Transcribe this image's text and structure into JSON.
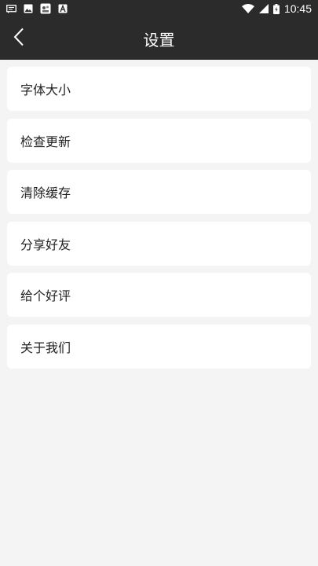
{
  "status_bar": {
    "time": "10:45",
    "icons": [
      "message-notification-icon",
      "image-notification-icon",
      "app-notification-icon",
      "font-app-icon",
      "wifi-icon",
      "signal-icon",
      "battery-icon"
    ]
  },
  "header": {
    "title": "设置",
    "back_icon": "chevron-left-icon"
  },
  "settings": {
    "items": [
      {
        "label": "字体大小"
      },
      {
        "label": "检查更新"
      },
      {
        "label": "清除缓存"
      },
      {
        "label": "分享好友"
      },
      {
        "label": "给个好评"
      },
      {
        "label": "关于我们"
      }
    ]
  },
  "colors": {
    "bar_background": "#2b2b2b",
    "page_background": "#f4f4f4",
    "card_background": "#ffffff"
  }
}
